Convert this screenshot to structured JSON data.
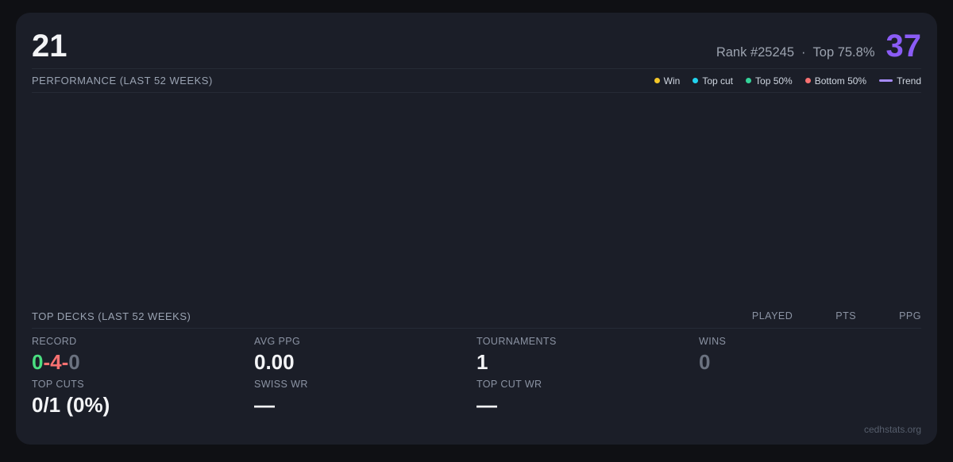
{
  "header": {
    "points": "21",
    "rank_label": "Rank #25245",
    "separator": "·",
    "top_percent_label": "Top 75.8%",
    "score": "37"
  },
  "performance": {
    "title": "PERFORMANCE (LAST 52 WEEKS)",
    "legend": [
      {
        "name": "win",
        "label": "Win",
        "color": "#f4c728",
        "marker": "dot"
      },
      {
        "name": "top-cut",
        "label": "Top cut",
        "color": "#22d3ee",
        "marker": "dot"
      },
      {
        "name": "top-50",
        "label": "Top 50%",
        "color": "#34d399",
        "marker": "dot"
      },
      {
        "name": "bottom-50",
        "label": "Bottom 50%",
        "color": "#f87171",
        "marker": "dot"
      },
      {
        "name": "trend",
        "label": "Trend",
        "color": "#a78bfa",
        "marker": "line"
      }
    ],
    "chart_points": []
  },
  "top_decks": {
    "title": "TOP DECKS (LAST 52 WEEKS)",
    "columns": [
      "PLAYED",
      "PTS",
      "PPG"
    ],
    "rows": []
  },
  "stats": {
    "record": {
      "label": "RECORD",
      "wins": "0",
      "losses": "4",
      "draws": "0",
      "separator": "-"
    },
    "top_cuts": {
      "label": "TOP CUTS",
      "value": "0/1 (0%)"
    },
    "avg_ppg": {
      "label": "AVG PPG",
      "value": "0.00"
    },
    "swiss_wr": {
      "label": "SWISS WR",
      "value": "—"
    },
    "tournaments": {
      "label": "TOURNAMENTS",
      "value": "1"
    },
    "top_cut_wr": {
      "label": "TOP CUT WR",
      "value": "—"
    },
    "wins": {
      "label": "WINS",
      "value": "0"
    }
  },
  "footer": {
    "watermark": "cedhstats.org"
  },
  "colors": {
    "page_background": "#0f1014",
    "card_background": "#1b1e28",
    "divider": "#262b36",
    "accent_purple": "#8b5cf6",
    "trend_purple": "#a78bfa",
    "win_yellow": "#f4c728",
    "top_cut_cyan": "#22d3ee",
    "top50_green": "#34d399",
    "bottom50_red": "#f87171",
    "record_win_green": "#4ade80",
    "record_loss_red": "#f87171",
    "record_draw_gray": "#6b7280"
  }
}
